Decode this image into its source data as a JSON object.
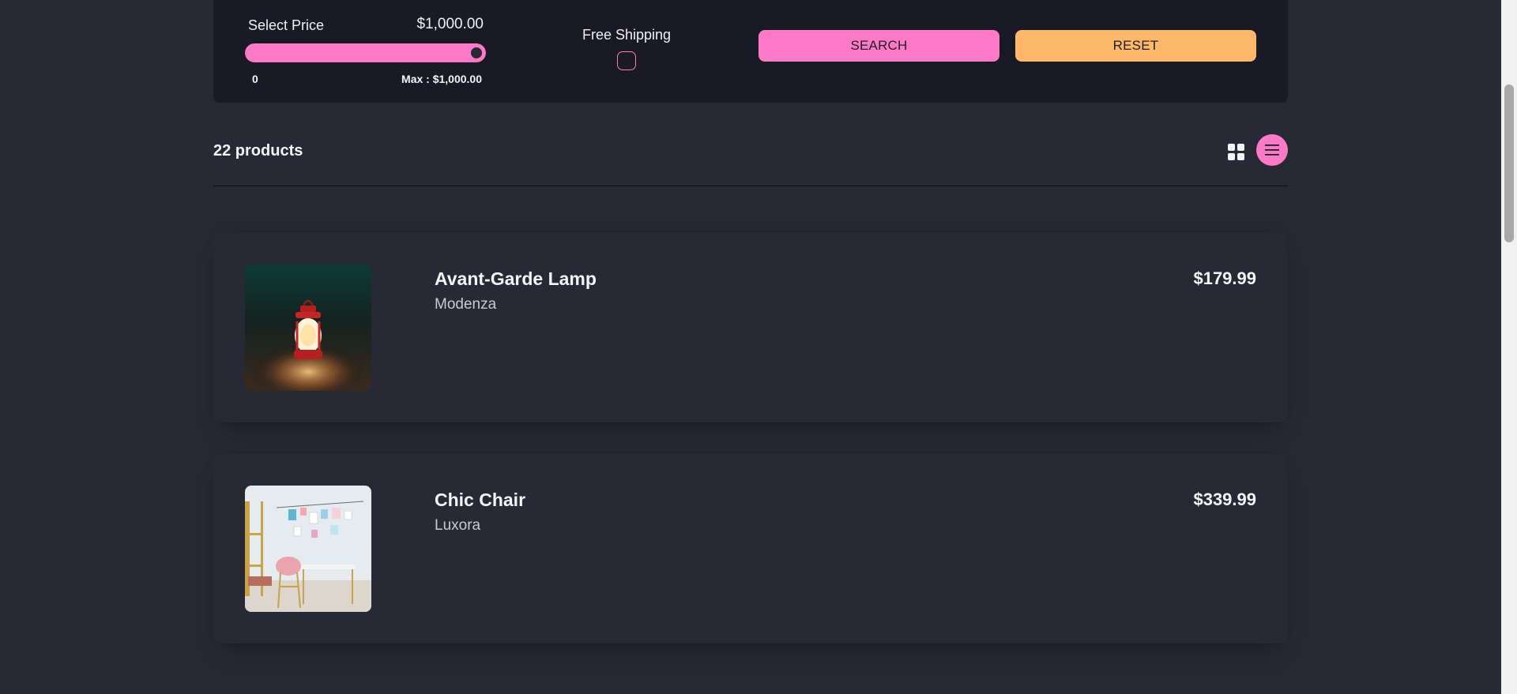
{
  "filters": {
    "price_label": "Select Price",
    "price_value": "$1,000.00",
    "range_min_label": "0",
    "range_max_label": "Max : $1,000.00",
    "range_fraction": 1.0,
    "shipping_label": "Free Shipping",
    "shipping_checked": false,
    "search_label": "SEARCH",
    "reset_label": "RESET"
  },
  "products_header": {
    "count_label": "22 products",
    "grid_icon": "grid-icon",
    "list_icon": "list-icon",
    "active_view": "list"
  },
  "products": [
    {
      "name": "Avant-Garde Lamp",
      "company": "Modenza",
      "price": "$179.99",
      "image_icon": "lantern-photo"
    },
    {
      "name": "Chic Chair",
      "company": "Luxora",
      "price": "$339.99",
      "image_icon": "room-chair-photo"
    }
  ],
  "colors": {
    "background": "#272935",
    "panel": "#191a23",
    "accent_pink": "#ff7ac6",
    "accent_orange": "#ffb86b"
  }
}
